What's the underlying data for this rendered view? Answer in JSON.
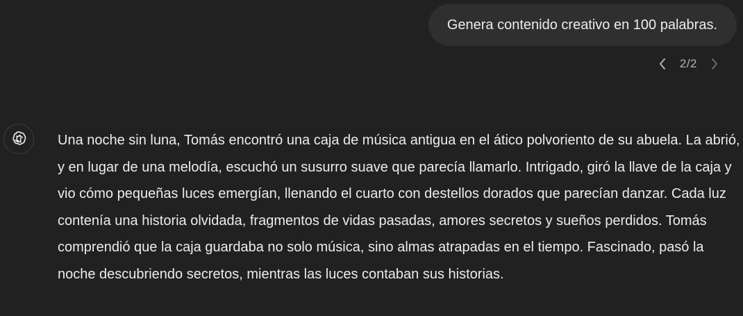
{
  "conversation": {
    "user_message": {
      "text": "Genera contenido creativo en 100 palabras."
    },
    "pagination": {
      "label": "2/2",
      "prev_icon": "chevron-left-icon",
      "next_icon": "chevron-right-icon"
    },
    "assistant_message": {
      "avatar_icon": "chatgpt-logo-icon",
      "text": "Una noche sin luna, Tomás encontró una caja de música antigua en el ático polvoriento de su abuela. La abrió, y en lugar de una melodía, escuchó un susurro suave que parecía llamarlo. Intrigado, giró la llave de la caja y vio cómo pequeñas luces emergían, llenando el cuarto con destellos dorados que parecían danzar. Cada luz contenía una historia olvidada, fragmentos de vidas pasadas, amores secretos y sueños perdidos. Tomás comprendió que la caja guardaba no solo música, sino almas atrapadas en el tiempo. Fascinado, pasó la noche descubriendo secretos, mientras las luces contaban sus historias."
    }
  },
  "colors": {
    "background": "#212121",
    "user_bubble": "#2f2f2f",
    "text": "#ececec",
    "muted": "#b4b4b4"
  }
}
